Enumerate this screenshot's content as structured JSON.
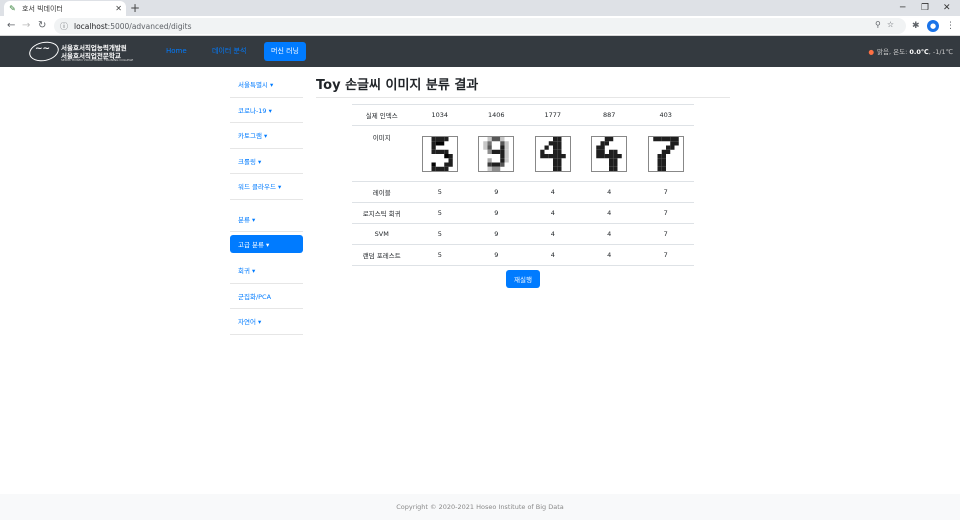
{
  "browser": {
    "tab_title": "호서 빅데이터",
    "url_host": "localhost",
    "url_path": ":5000/advanced/digits"
  },
  "site": {
    "logo_line1": "서울호서직업능력개발원",
    "logo_line2": "서울호서직업전문학교",
    "logo_line3": "SEOUL HOSEO VOCATIONAL TRAINING COLLEGE",
    "nav": [
      "Home",
      "데이터 분석",
      "머신 러닝"
    ],
    "weather_prefix": "맑음, 온도: ",
    "weather_temp": "0.0℃",
    "weather_range": ", -1/1℃"
  },
  "sidebar": {
    "items": [
      "서울특별시 ▾",
      "코로나-19 ▾",
      "카토그램 ▾",
      "크롤링 ▾",
      "워드 클라우드 ▾",
      "분류 ▾",
      "고급 분류 ▾",
      "회귀 ▾",
      "군집화/PCA",
      "자연어 ▾"
    ]
  },
  "main": {
    "title": "Toy 손글씨 이미지 분류 결과",
    "row_labels": [
      "실제 인덱스",
      "이미지",
      "레이블",
      "로지스틱 회귀",
      "SVM",
      "랜덤 포레스트"
    ],
    "columns": [
      {
        "index": "1034",
        "label": "5",
        "logistic": "5",
        "svm": "5",
        "rf": "5",
        "digit": "5"
      },
      {
        "index": "1406",
        "label": "9",
        "logistic": "9",
        "svm": "9",
        "rf": "9",
        "digit": "9"
      },
      {
        "index": "1777",
        "label": "4",
        "logistic": "4",
        "svm": "4",
        "rf": "4",
        "digit": "4"
      },
      {
        "index": "887",
        "label": "4",
        "logistic": "4",
        "svm": "4",
        "rf": "4",
        "digit": "4"
      },
      {
        "index": "403",
        "label": "7",
        "logistic": "7",
        "svm": "7",
        "rf": "7",
        "digit": "7"
      }
    ],
    "rerun_label": "재실행"
  },
  "footer": {
    "text": "Copyright © 2020-2021 Hoseo Institute of Big Data"
  }
}
